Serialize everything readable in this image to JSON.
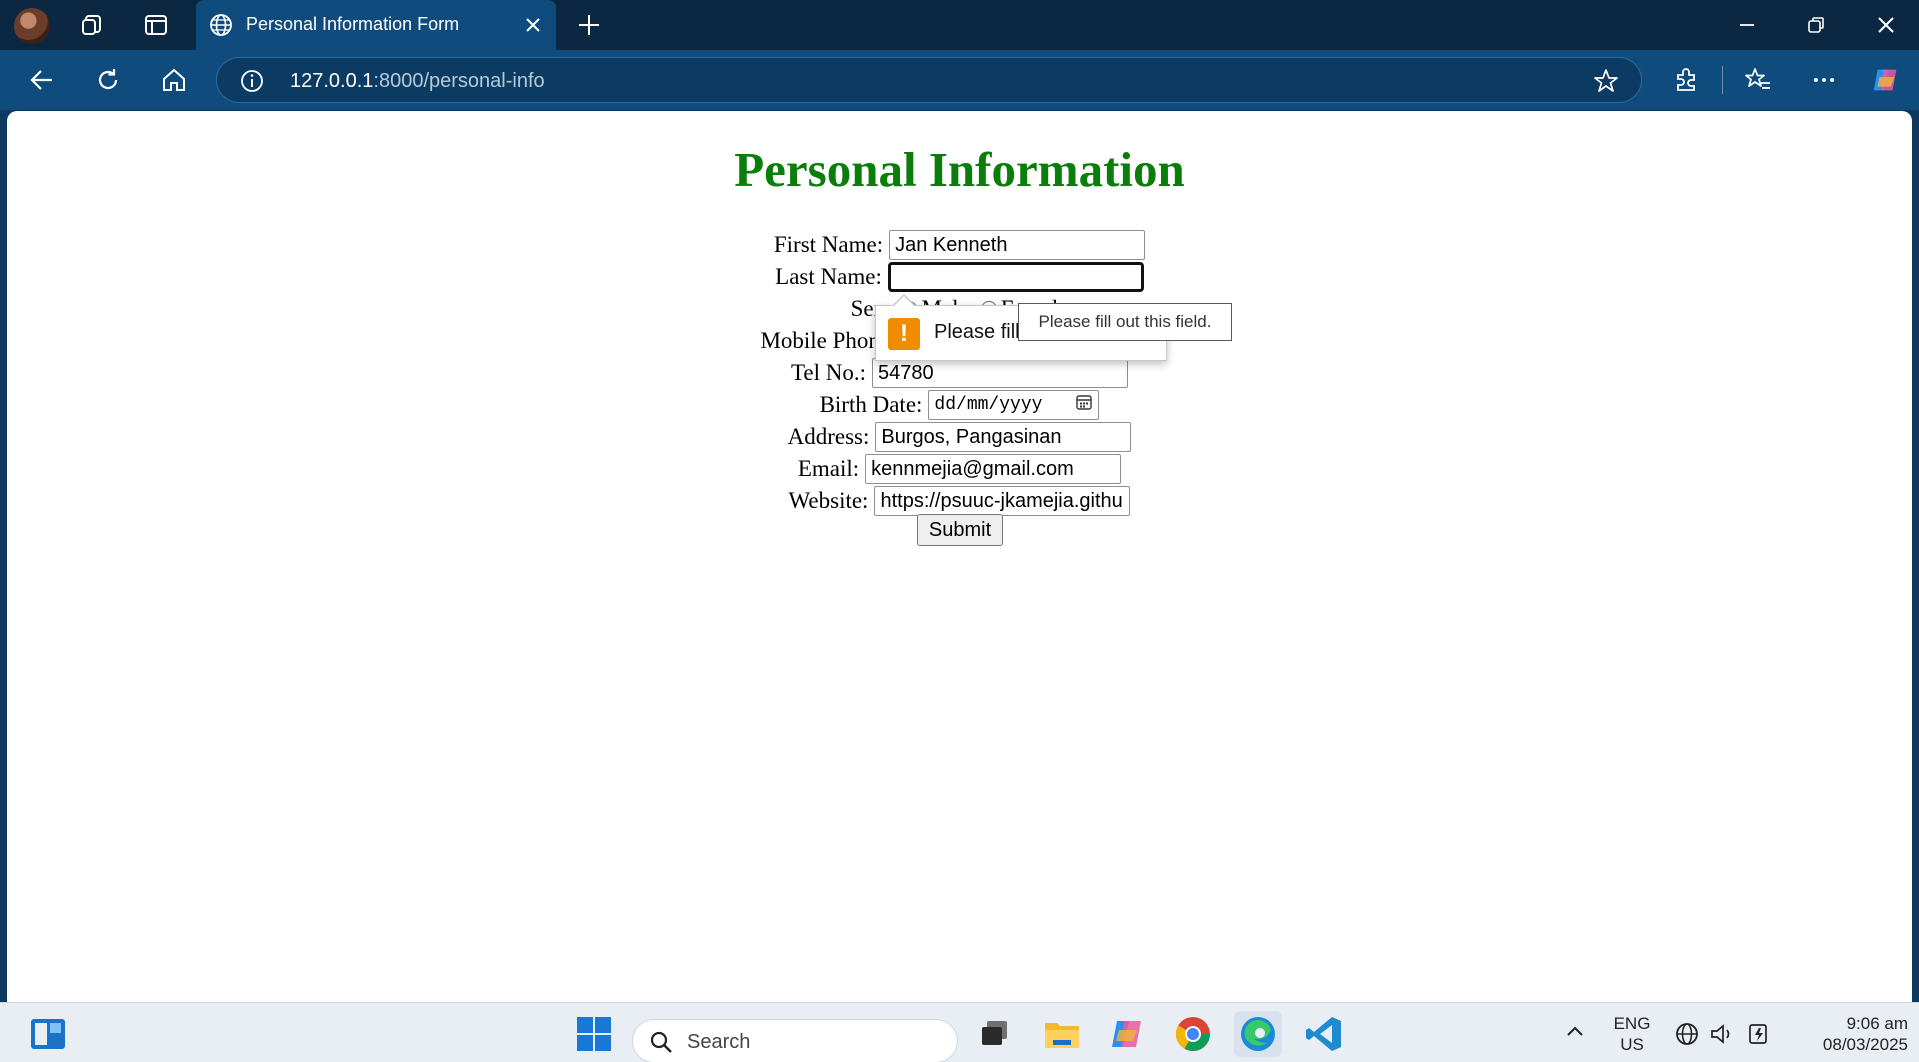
{
  "browser": {
    "tab_title": "Personal Information Form",
    "url_host": "127.0.0.1",
    "url_path": ":8000/personal-info"
  },
  "page": {
    "title": "Personal Information",
    "title_color": "#0a7d0a",
    "fields": {
      "first_name_label": "First Name:",
      "first_name_value": "Jan Kenneth",
      "last_name_label": "Last Name:",
      "last_name_value": "",
      "sex_label": "Sex:",
      "male_label": "Male",
      "female_label": "Female",
      "mobile_label": "Mobile Phone:",
      "tel_label": "Tel No.:",
      "tel_value": "54780",
      "birth_label": "Birth Date:",
      "birth_placeholder": "dd/mm/yyyy",
      "address_label": "Address:",
      "address_value": "Burgos, Pangasinan",
      "email_label": "Email:",
      "email_value": "kennmejia@gmail.com",
      "website_label": "Website:",
      "website_value": "https://psuuc-jkamejia.githu"
    },
    "submit_label": "Submit",
    "validation_message": "Please fill out this field.",
    "tooltip_text": "Please fill out this field."
  },
  "taskbar": {
    "search_placeholder": "Search",
    "lang_top": "ENG",
    "lang_bottom": "US",
    "time": "9:06 am",
    "date": "08/03/2025"
  }
}
